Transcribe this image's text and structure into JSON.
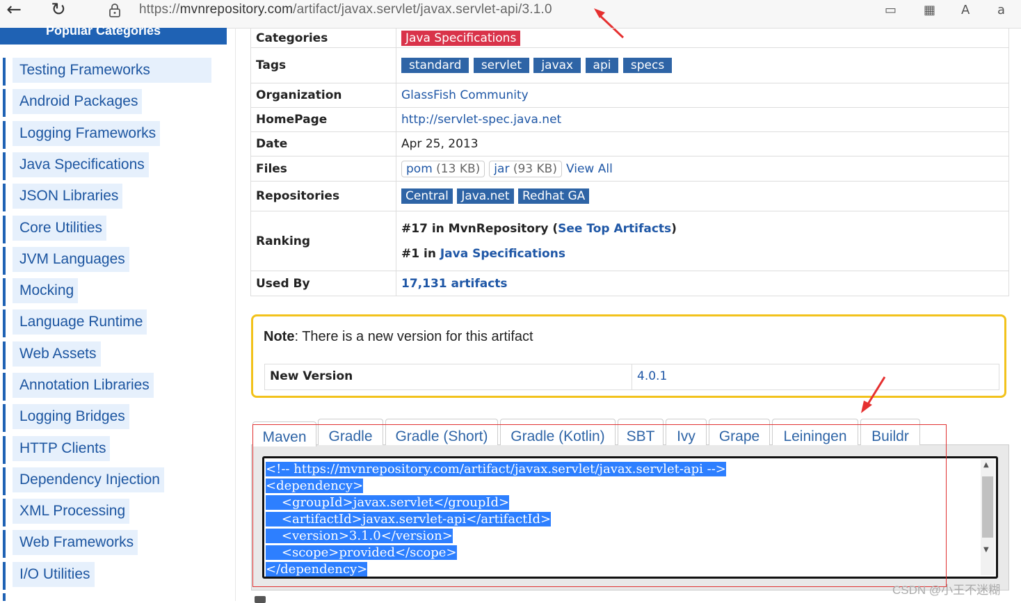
{
  "browser": {
    "url_prefix": "https://",
    "url_main": "mvnrepository.com",
    "url_path": "/artifact/javax.servlet/javax.servlet-api/3.1.0"
  },
  "sidebar": {
    "header": "Popular Categories",
    "items": [
      "Testing Frameworks",
      "Android Packages",
      "Logging Frameworks",
      "Java Specifications",
      "JSON Libraries",
      "Core Utilities",
      "JVM Languages",
      "Mocking",
      "Language Runtime",
      "Web Assets",
      "Annotation Libraries",
      "Logging Bridges",
      "HTTP Clients",
      "Dependency Injection",
      "XML Processing",
      "Web Frameworks",
      "I/O Utilities"
    ]
  },
  "info": {
    "categories_label": "Categories",
    "categories_value": "Java Specifications",
    "tags_label": "Tags",
    "tags": [
      "standard",
      "servlet",
      "javax",
      "api",
      "specs"
    ],
    "organization_label": "Organization",
    "organization_value": "GlassFish Community",
    "homepage_label": "HomePage",
    "homepage_value": "http://servlet-spec.java.net",
    "date_label": "Date",
    "date_value": "Apr 25, 2013",
    "files_label": "Files",
    "files": [
      {
        "name": "pom",
        "size": "(13 KB)"
      },
      {
        "name": "jar",
        "size": "(93 KB)"
      }
    ],
    "view_all": "View All",
    "repositories_label": "Repositories",
    "repositories": [
      "Central",
      "Java.net",
      "Redhat GA"
    ],
    "ranking_label": "Ranking",
    "ranking1_prefix": "#17 in MvnRepository (",
    "ranking1_link": "See Top Artifacts",
    "ranking1_suffix": ")",
    "ranking2_prefix": "#1 in ",
    "ranking2_link": "Java Specifications",
    "usedby_label": "Used By",
    "usedby_value": "17,131 artifacts"
  },
  "note": {
    "bold": "Note",
    "text": ": There is a new version for this artifact",
    "new_version_label": "New Version",
    "new_version_value": "4.0.1"
  },
  "tabs": [
    "Maven",
    "Gradle",
    "Gradle (Short)",
    "Gradle (Kotlin)",
    "SBT",
    "Ivy",
    "Grape",
    "Leiningen",
    "Buildr"
  ],
  "code_lines": [
    "<!-- https://mvnrepository.com/artifact/javax.servlet/javax.servlet-api -->",
    "<dependency>",
    "    <groupId>javax.servlet</groupId>",
    "    <artifactId>javax.servlet-api</artifactId>",
    "    <version>3.1.0</version>",
    "    <scope>provided</scope>",
    "</dependency>"
  ],
  "watermark": "CSDN @小王不迷糊",
  "colors": {
    "accent": "#1f62b4",
    "tag_red": "#d9334a",
    "note_border": "#f2c21b",
    "selection": "#2d7fff"
  }
}
